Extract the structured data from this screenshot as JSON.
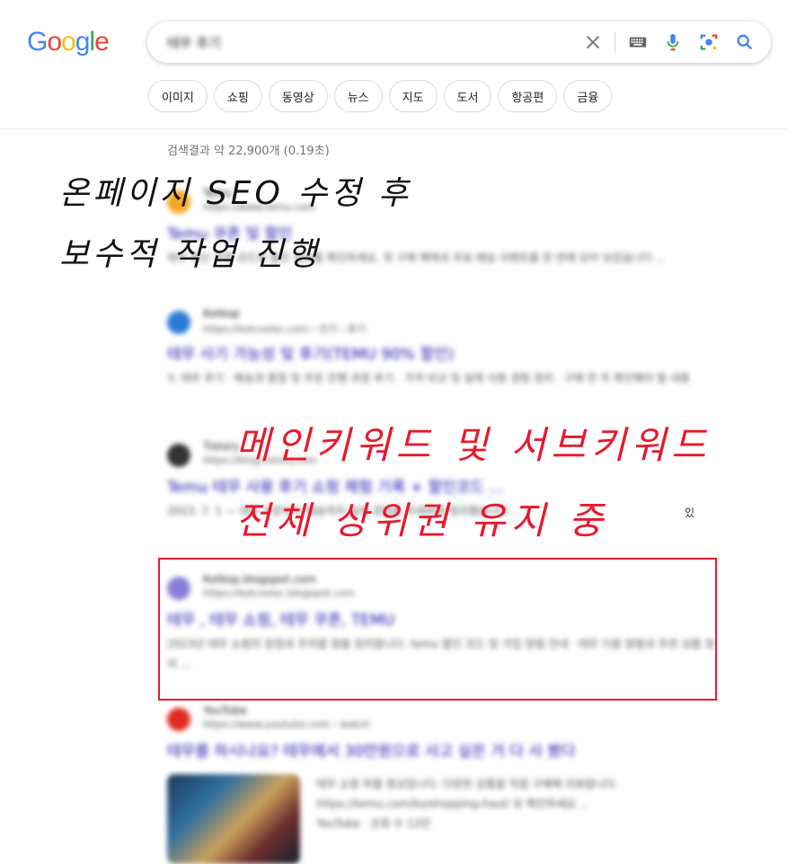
{
  "logo": {
    "letters": [
      "G",
      "o",
      "o",
      "g",
      "l",
      "e"
    ],
    "colors": [
      "#4285F4",
      "#EA4335",
      "#FBBC05",
      "#4285F4",
      "#34A853",
      "#EA4335"
    ]
  },
  "search": {
    "query": "테무 후기",
    "icons": [
      "clear-icon",
      "keyboard-icon",
      "mic-icon",
      "lens-icon",
      "search-icon"
    ]
  },
  "chips": [
    "이미지",
    "쇼핑",
    "동영상",
    "뉴스",
    "지도",
    "도서",
    "항공편",
    "금융"
  ],
  "stats": "검색결과 약 22,900개 (0.19초)",
  "results": [
    {
      "site": "Temu",
      "url": "https://www.temu.com",
      "title": "Temu 쿠폰 및 할인",
      "snippet": "테무 최신 쿠폰 코드와 할인 정보를 확인하세요. 첫 구매 혜택과 무료 배송 이벤트를 한 번에 모아 보았습니다 ...",
      "favicon_color": "#f5a623"
    },
    {
      "site": "Kotkop",
      "url": "https://kotcoolsc.com › 인기 › 후기",
      "title": "테무 사기 가능성 및 후기(TEMU 90% 할인)",
      "snippet": "3. 테무 후기 · 배송과 품질 및 주문 진행 과정 후기 · 가격 비교 및 실제 사용 경험 정리 · 구매 전 꼭 확인해야 할 내용",
      "favicon_color": "#2b7bd6"
    },
    {
      "site": "Tistory",
      "url": "https://blog.tistory.com",
      "title": "Temu 테무 사용 후기 쇼핑 체험 기록 + 할인코드 ...",
      "snippet": "2023. 7. 1 — 테무 주문부터 배송까지 실제 경험을 자세하게 정리했습니다 ...",
      "favicon_color": "#333333"
    },
    {
      "site": "Kotkop.blogspot.com",
      "url": "https://kotcoolsc.blogspot.com",
      "title": "테무 , 테무 쇼핑, 테무 쿠폰, TEMU",
      "snippet": "2023년 테무 쇼핑의 장점과 주의할 점을 정리합니다. temu 할인 코드 및 가입 방법 안내 · 테무 이용 방법과 추천 상품 정리 ...",
      "favicon_color": "#8a7fd6"
    },
    {
      "site": "YouTube",
      "url": "https://www.youtube.com › watch",
      "title": "테무를 하시나요? 테무에서 30만원으로 사고 싶은 거 다 사 봤다",
      "snippet": "테무 쇼핑 하울 영상입니다. 다양한 상품을 직접 구매해 리뷰합니다. https://temu.com/ko/shopping-haul/ 로 확인하세요 ...",
      "source": "YouTube · 조회 수 12만",
      "favicon_color": "#e02b20"
    }
  ],
  "overlay": {
    "black_line1": "온페이지  SEO  수정  후",
    "black_line2": "보수적  작업  진행",
    "red_line1": "메인키워드  및  서브키워드",
    "red_line2": "전체  상위권  유지  중",
    "red_color": "#e8192c"
  },
  "stray_char": "있"
}
